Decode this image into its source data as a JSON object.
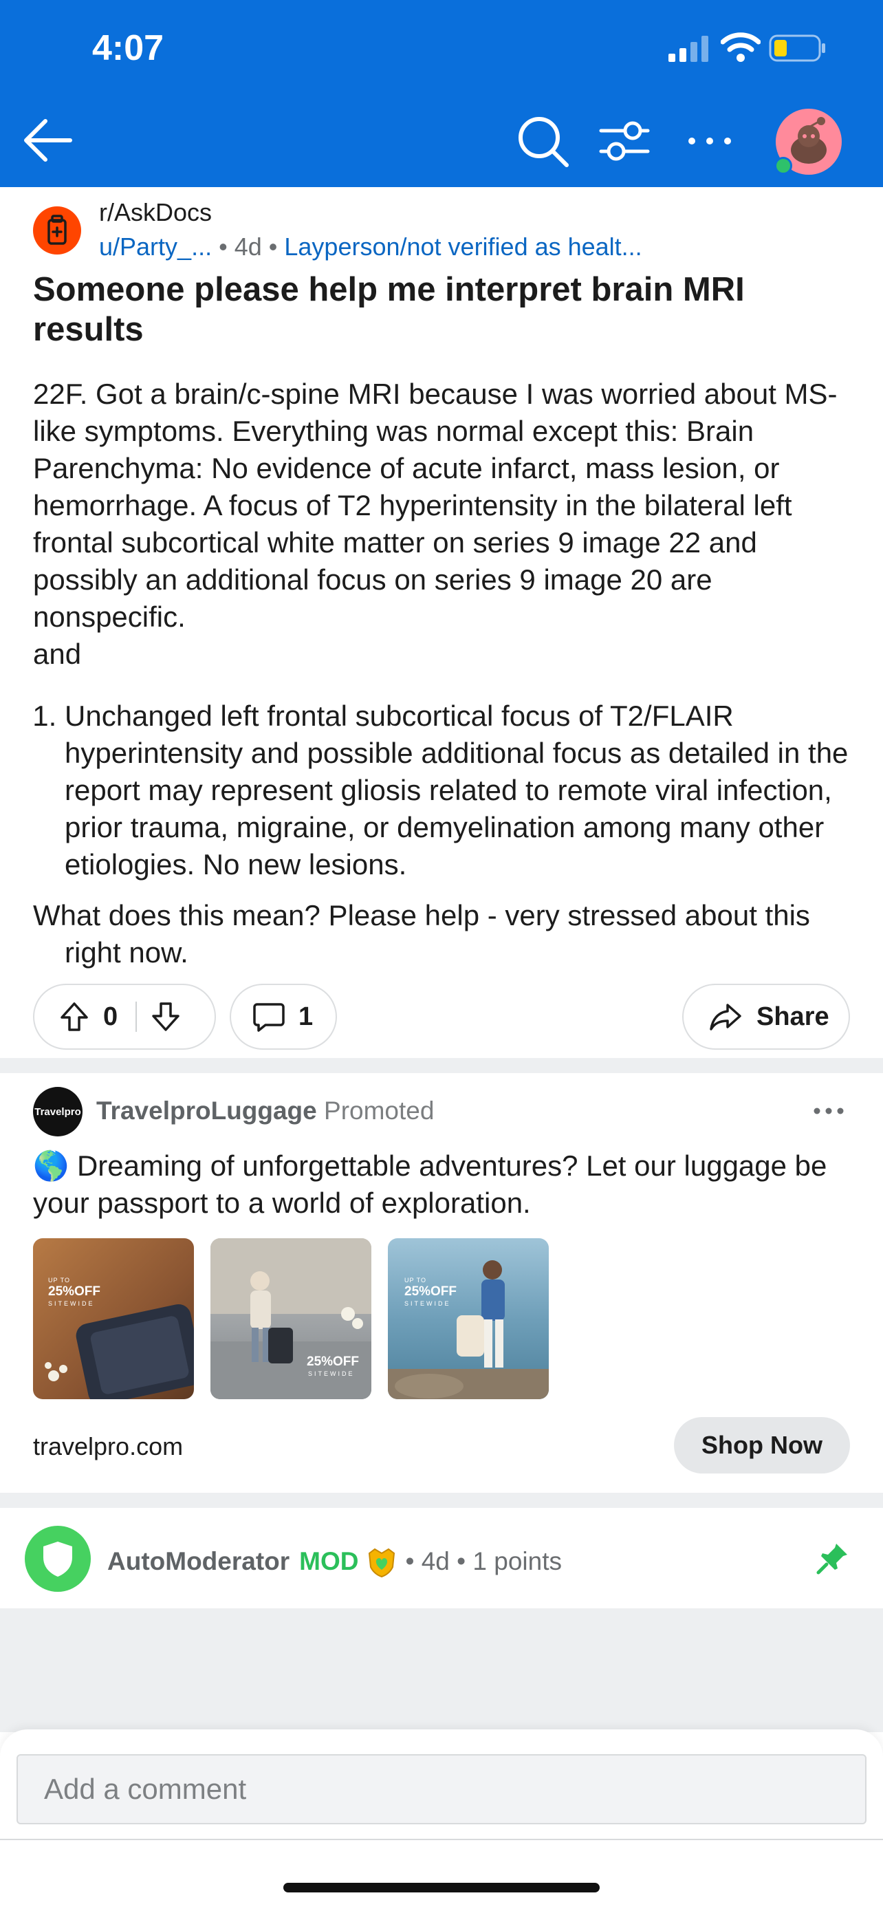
{
  "status_bar": {
    "time": "4:07"
  },
  "nav": {
    "back_icon": "arrow-left-icon",
    "search_icon": "search-icon",
    "filter_icon": "filter-icon",
    "more_icon": "more-horizontal-icon",
    "avatar_icon": "snoo-avatar-icon"
  },
  "post": {
    "subreddit": "r/AskDocs",
    "author": "u/Party_...",
    "age": "• 4d •",
    "flair": "Layperson/not verified as healt...",
    "title": "Someone please help me interpret brain MRI results",
    "body_paragraph": "22F. Got a brain/c-spine MRI because I was worried about MS-like symptoms. Everything was normal except this: Brain Parenchyma: No evidence of acute infarct, mass lesion, or hemorrhage. A focus of T2 hyperintensity in the bilateral left frontal subcortical white matter on series 9 image 22 and possibly an additional focus on series 9 image 20 are nonspecific.",
    "body_and": "and",
    "list_items": [
      "Unchanged left frontal subcortical focus of T2/FLAIR hyperintensity and possible additional focus as detailed in the report may represent gliosis related to remote viral infection, prior trauma, migraine, or demyelination among many other etiologies. No new lesions."
    ],
    "question": "What does this mean? Please help - very stressed about this right now.",
    "votes": "0",
    "comments": "1",
    "share_label": "Share"
  },
  "ad": {
    "avatar_text": "Travelpro",
    "advertiser": "TravelproLuggage",
    "promoted_label": "Promoted",
    "text": "🌎 Dreaming of unforgettable adventures? Let our luggage be your passport to a world of exploration.",
    "image_badge_top": "UP TO",
    "image_badge_main": "25%OFF",
    "image_badge_sub": "SITEWIDE",
    "domain": "travelpro.com",
    "cta": "Shop Now"
  },
  "comment": {
    "author": "AutoModerator",
    "mod_tag": "MOD",
    "meta": "• 4d • 1 points"
  },
  "composer": {
    "placeholder": "Add a comment"
  },
  "colors": {
    "header_bg": "#0a6fdb",
    "subreddit_orange": "#ff4500",
    "link_blue": "#0a66c2",
    "mod_green": "#2bbf5a"
  }
}
